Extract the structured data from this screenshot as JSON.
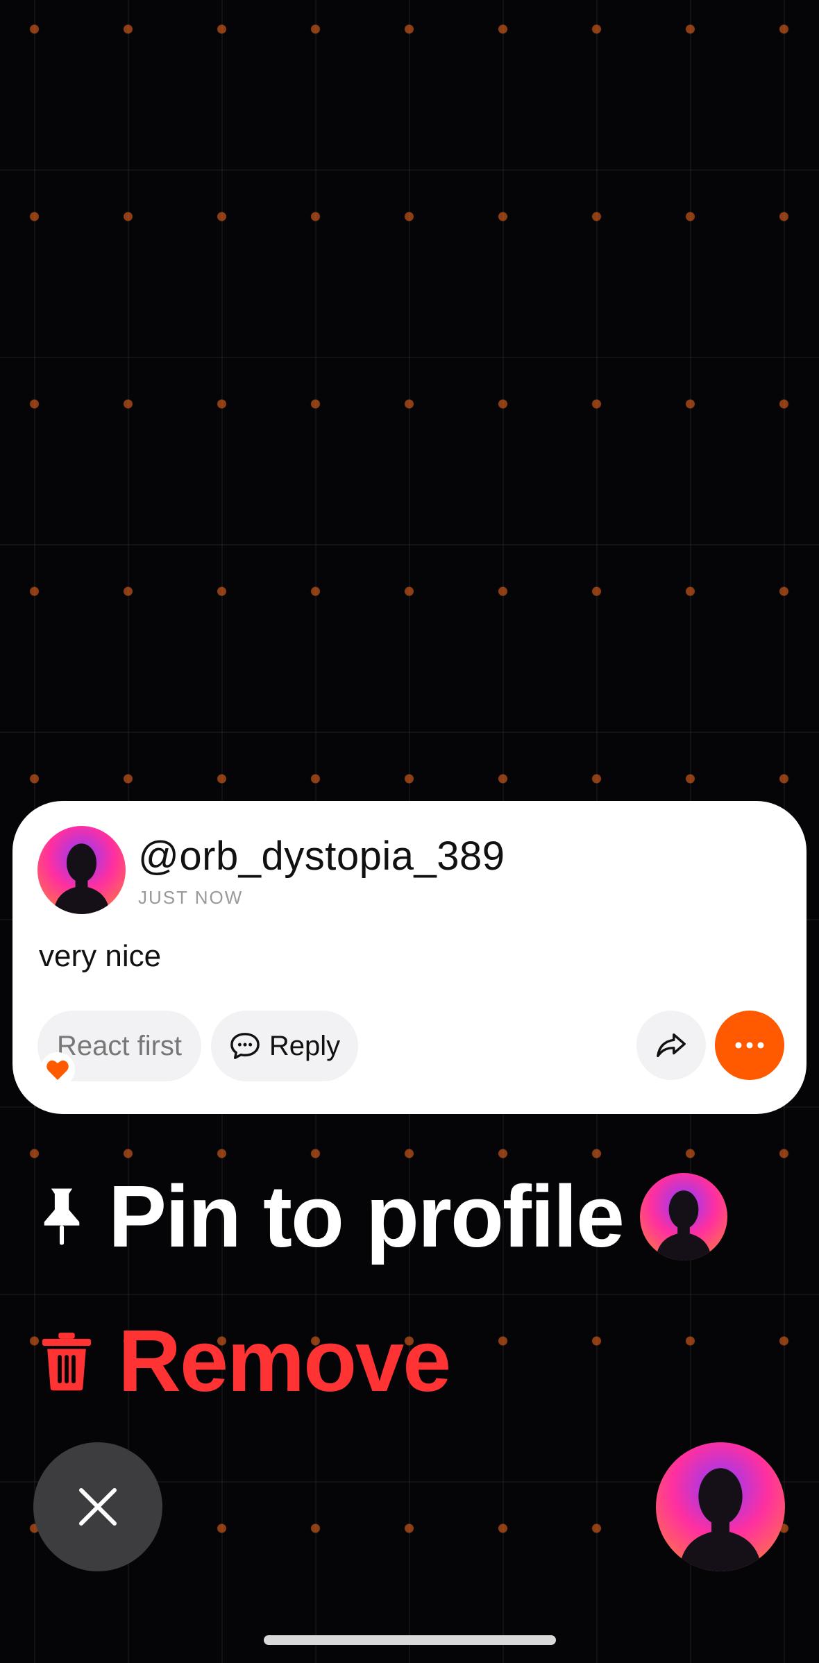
{
  "comment_card": {
    "username": "@orb_dystopia_389",
    "timestamp": "JUST NOW",
    "text": "very nice",
    "react_label": "React first",
    "reply_label": "Reply",
    "reaction_icon": "heart-icon",
    "share_icon": "share-icon",
    "more_icon": "more-icon"
  },
  "menu": {
    "pin_label": "Pin to profile",
    "pin_icon": "pin-icon",
    "remove_label": "Remove",
    "remove_icon": "trash-icon"
  },
  "controls": {
    "close_icon": "close-icon"
  },
  "colors": {
    "accent": "#ff5a00",
    "danger": "#ff3333",
    "background": "#050507",
    "card": "#ffffff"
  }
}
